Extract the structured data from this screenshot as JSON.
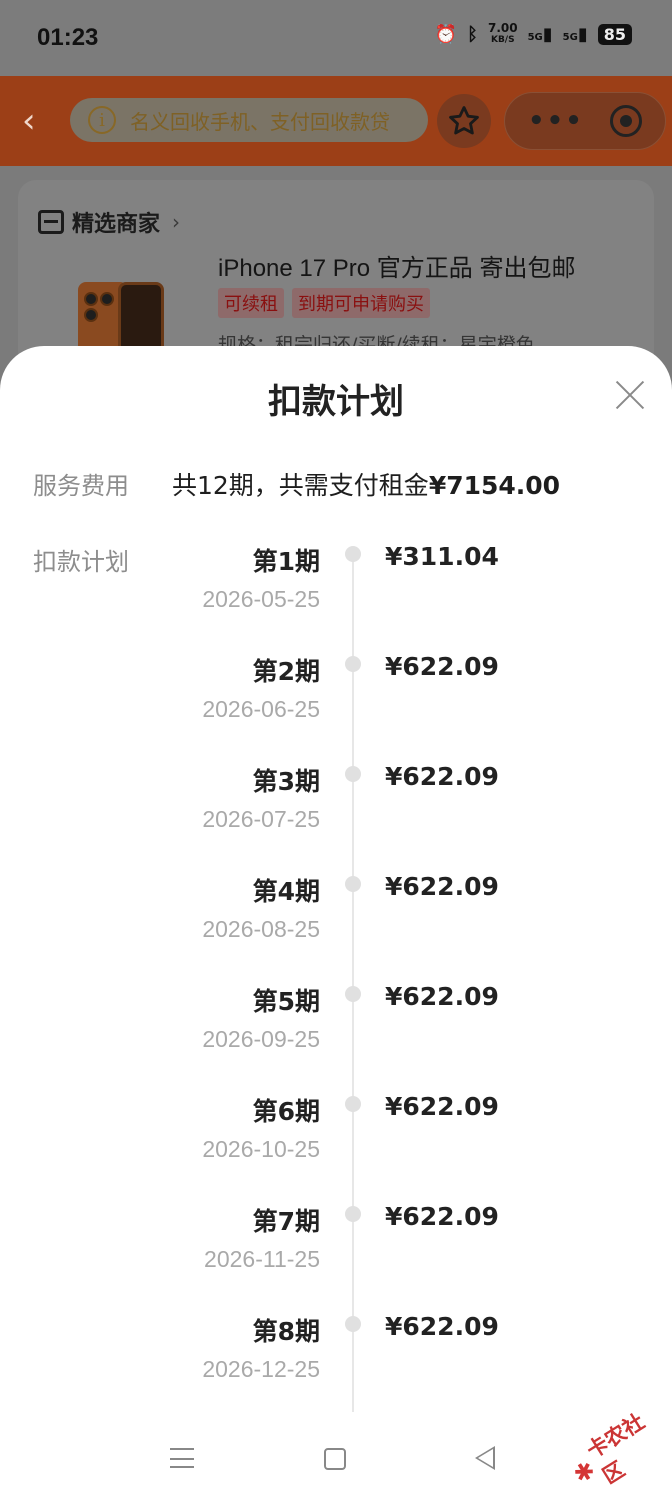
{
  "status_bar": {
    "time": "01:23",
    "speed_top": "7.00",
    "speed_bottom": "KB/S",
    "signal1": "5G",
    "signal2": "5G",
    "battery": "85"
  },
  "header": {
    "search_placeholder": "名义回收手机、支付回收款贷",
    "accent_color": "#e85b23"
  },
  "card": {
    "merchant_label": "精选商家",
    "product_title": "iPhone 17 Pro 官方正品 寄出包邮",
    "tags": [
      "可续租",
      "到期可申请购买"
    ],
    "spec": "规格：租完归还/买断/续租；星宇橙色"
  },
  "sheet": {
    "title": "扣款计划",
    "fee_label": "服务费用",
    "fee_prefix": "共12期，共需支付租金",
    "fee_total": "¥7154.00",
    "plan_label": "扣款计划",
    "schedule": [
      {
        "period": "第1期",
        "date": "2026-05-25",
        "amount": "¥311.04"
      },
      {
        "period": "第2期",
        "date": "2026-06-25",
        "amount": "¥622.09"
      },
      {
        "period": "第3期",
        "date": "2026-07-25",
        "amount": "¥622.09"
      },
      {
        "period": "第4期",
        "date": "2026-08-25",
        "amount": "¥622.09"
      },
      {
        "period": "第5期",
        "date": "2026-09-25",
        "amount": "¥622.09"
      },
      {
        "period": "第6期",
        "date": "2026-10-25",
        "amount": "¥622.09"
      },
      {
        "period": "第7期",
        "date": "2026-11-25",
        "amount": "¥622.09"
      },
      {
        "period": "第8期",
        "date": "2026-12-25",
        "amount": "¥622.09"
      }
    ]
  },
  "watermark": "卡农社区",
  "icons": {
    "back": "chevron-left-icon",
    "info": "info-icon",
    "favorite": "star-icon",
    "more": "more-dots-icon",
    "record": "target-icon",
    "close": "close-icon"
  }
}
